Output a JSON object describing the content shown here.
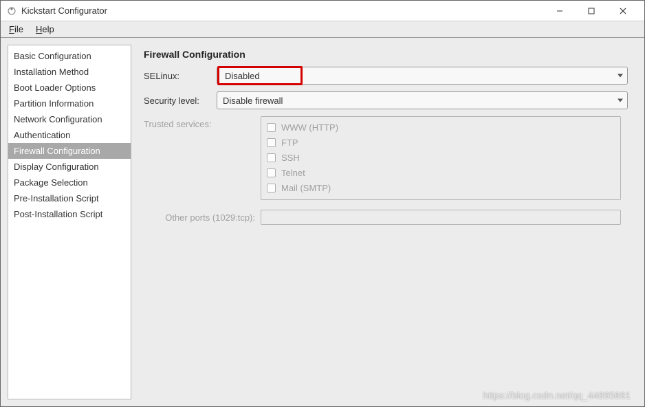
{
  "window": {
    "title": "Kickstart Configurator"
  },
  "menubar": {
    "file": "File",
    "help": "Help"
  },
  "sidebar": {
    "items": [
      {
        "label": "Basic Configuration",
        "selected": false
      },
      {
        "label": "Installation Method",
        "selected": false
      },
      {
        "label": "Boot Loader Options",
        "selected": false
      },
      {
        "label": "Partition Information",
        "selected": false
      },
      {
        "label": "Network Configuration",
        "selected": false
      },
      {
        "label": "Authentication",
        "selected": false
      },
      {
        "label": "Firewall Configuration",
        "selected": true
      },
      {
        "label": "Display Configuration",
        "selected": false
      },
      {
        "label": "Package Selection",
        "selected": false
      },
      {
        "label": "Pre-Installation Script",
        "selected": false
      },
      {
        "label": "Post-Installation Script",
        "selected": false
      }
    ]
  },
  "main": {
    "heading": "Firewall Configuration",
    "selinux_label": "SELinux:",
    "selinux_value": "Disabled",
    "security_label": "Security level:",
    "security_value": "Disable firewall",
    "trusted_label": "Trusted services:",
    "trusted_services": [
      "WWW (HTTP)",
      "FTP",
      "SSH",
      "Telnet",
      "Mail (SMTP)"
    ],
    "ports_label": "Other ports (1029:tcp):",
    "ports_value": ""
  },
  "watermark": "https://blog.csdn.net/qq_44895681"
}
